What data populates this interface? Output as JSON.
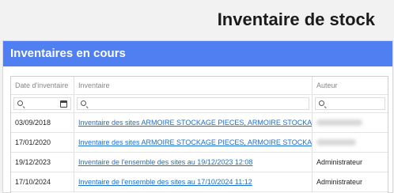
{
  "page": {
    "title": "Inventaire de stock"
  },
  "panel": {
    "title": "Inventaires en cours"
  },
  "table": {
    "columns": [
      "Date d'inventaire",
      "Inventaire",
      "Auteur"
    ],
    "rows": [
      {
        "date": "03/09/2018",
        "inventory": "Inventaire des sites ARMOIRE STOCKAGE PIECES, ARMOIRE STOCKA...",
        "author": ""
      },
      {
        "date": "17/01/2020",
        "inventory": "Inventaire des sites ARMOIRE STOCKAGE PIECES, ARMOIRE STOCKA...",
        "author": ""
      },
      {
        "date": "19/12/2023",
        "inventory": "Inventaire de l'ensemble des sites au 19/12/2023 12:08",
        "author": "Administrateur"
      },
      {
        "date": "17/10/2024",
        "inventory": "Inventaire de l'ensemble des sites au 17/10/2024 11:12",
        "author": "Administrateur"
      }
    ]
  },
  "icons": {
    "filter_search": "search-icon",
    "date_picker": "calendar-icon"
  },
  "colors": {
    "panel_header": "#4f7ff0",
    "link": "#1a6ed8"
  }
}
